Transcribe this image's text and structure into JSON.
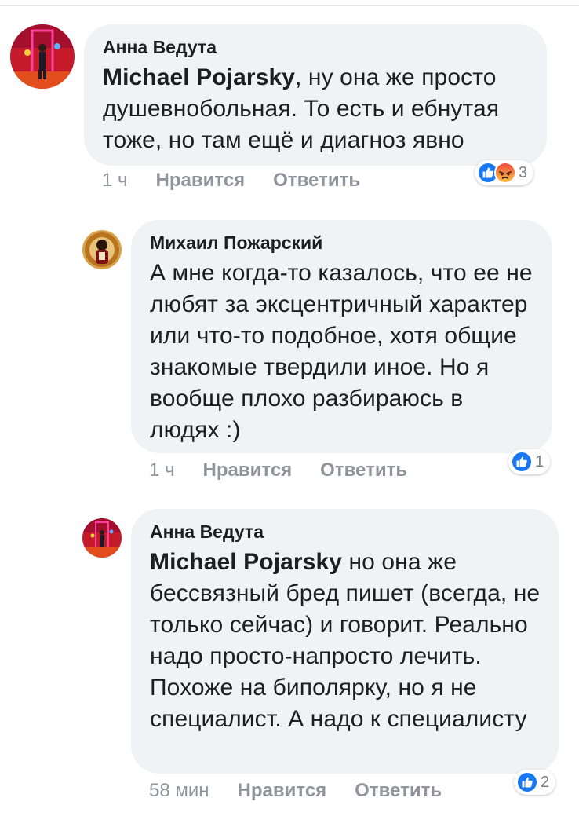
{
  "colors": {
    "bubble": "#f1f2f6",
    "text": "#1c1e21",
    "meta": "#90949c",
    "like_blue": "#1877f2",
    "angry_orange": "#f5643d"
  },
  "comments": [
    {
      "author": "Анна Ведута",
      "mention": "Michael Pojarsky",
      "text": ", ну она же просто душевнобольная. То есть и ебнутая тоже, но там ещё и диагноз явно",
      "time": "1 ч",
      "like_label": "Нравится",
      "reply_label": "Ответить",
      "reaction_icons": [
        "like-icon",
        "angry-icon"
      ],
      "reaction_count": "3"
    },
    {
      "author": "Михаил Пожарский",
      "mention": "",
      "text": "А мне когда-то казалось, что ее не любят за эксцентричный характер или что-то подобное, хотя общие знакомые твердили иное. Но я вообще плохо разбираюсь в людях :)",
      "time": "1 ч",
      "like_label": "Нравится",
      "reply_label": "Ответить",
      "reaction_icons": [
        "like-icon"
      ],
      "reaction_count": "1"
    },
    {
      "author": "Анна Ведута",
      "mention": "Michael Pojarsky",
      "text": " но она же бессвязный бред пишет (всегда, не только сейчас) и говорит. Реально надо просто-напросто лечить. Похоже на биполярку, но я не специалист. А надо к специалисту",
      "time": "58 мин",
      "like_label": "Нравится",
      "reply_label": "Ответить",
      "reaction_icons": [
        "like-icon"
      ],
      "reaction_count": "2"
    }
  ]
}
